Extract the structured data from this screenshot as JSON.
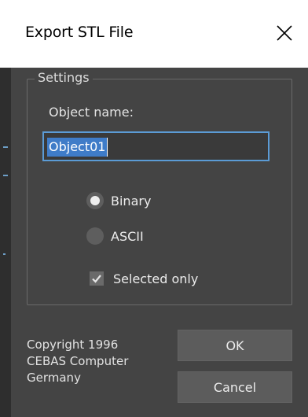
{
  "window": {
    "title": "Export STL File",
    "close_icon": "close-icon"
  },
  "settings": {
    "group_label": "Settings",
    "object_name_label": "Object name:",
    "object_name_value": "Object01",
    "format_options": [
      {
        "label": "Binary",
        "checked": true
      },
      {
        "label": "ASCII",
        "checked": false
      }
    ],
    "selected_only_label": "Selected only",
    "selected_only_checked": true
  },
  "footer": {
    "copyright_lines": [
      "Copyright 1996",
      "CEBAS Computer",
      "Germany"
    ],
    "ok_label": "OK",
    "cancel_label": "Cancel"
  },
  "colors": {
    "dialog_bg": "#444444",
    "titlebar_bg": "#ffffff",
    "input_border": "#5b9bd5",
    "selection": "#3f7cc8",
    "button_bg": "#5c5c5c"
  }
}
